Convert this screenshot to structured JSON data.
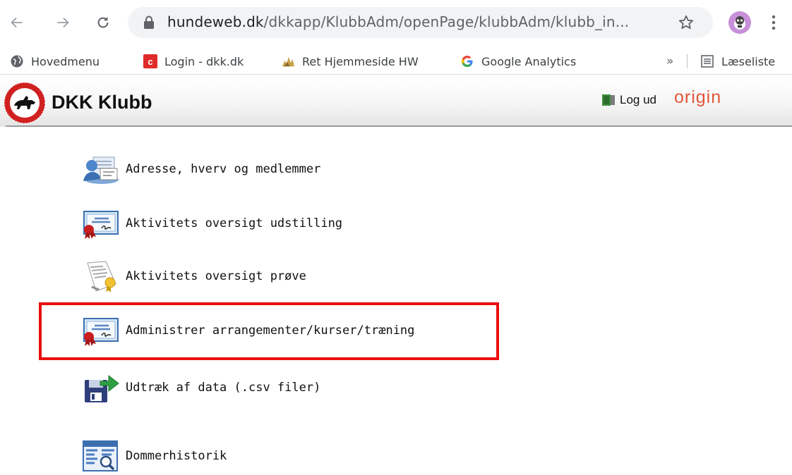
{
  "browser": {
    "url_host": "hundeweb.dk",
    "url_path": "/dkkapp/KlubbAdm/openPage/klubbAdm/klubb_in...",
    "nav": {
      "back": "back-arrow-icon",
      "forward": "forward-arrow-icon",
      "reload": "reload-icon"
    }
  },
  "bookmarks": {
    "items": [
      {
        "label": "Hovedmenu",
        "icon": "globe-icon"
      },
      {
        "label": "Login - dkk.dk",
        "icon": "c-favicon"
      },
      {
        "label": "Ret Hjemmeside HW",
        "icon": "dog-favicon"
      },
      {
        "label": "Google Analytics",
        "icon": "google-icon"
      }
    ],
    "overflow": "»",
    "reading_list": "Læseliste"
  },
  "app": {
    "title": "DKK Klubb",
    "logout": "Log ud",
    "brand": "origin",
    "brand_color": "#e2553a"
  },
  "menu": {
    "items": [
      {
        "label": "Adresse, hverv og medlemmer",
        "icon": "address-book-icon"
      },
      {
        "label": "Aktivitets oversigt udstilling",
        "icon": "certificate-icon"
      },
      {
        "label": "Aktivitets oversigt prøve",
        "icon": "document-seal-icon"
      },
      {
        "label": "Administrer arrangementer/kurser/træning",
        "icon": "certificate-icon",
        "highlighted": true
      },
      {
        "label": "Udtræk af data (.csv filer)",
        "icon": "floppy-export-icon"
      },
      {
        "label": "Dommerhistorik",
        "icon": "report-search-icon"
      }
    ],
    "highlight_color": "#e8100f"
  }
}
